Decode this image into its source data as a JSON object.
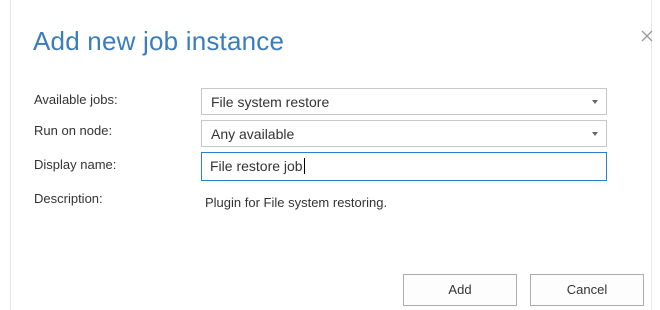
{
  "dialog": {
    "title": "Add new job instance",
    "close_icon": "close-icon"
  },
  "form": {
    "available_jobs": {
      "label": "Available jobs:",
      "value": "File system restore"
    },
    "run_on_node": {
      "label": "Run on node:",
      "value": "Any available"
    },
    "display_name": {
      "label": "Display name:",
      "value": "File restore job"
    },
    "description": {
      "label": "Description:",
      "value": "Plugin for File system restoring."
    }
  },
  "buttons": {
    "add": "Add",
    "cancel": "Cancel"
  },
  "colors": {
    "title": "#3a7dbd",
    "focus_border": "#2b80c8",
    "text": "#333333"
  }
}
